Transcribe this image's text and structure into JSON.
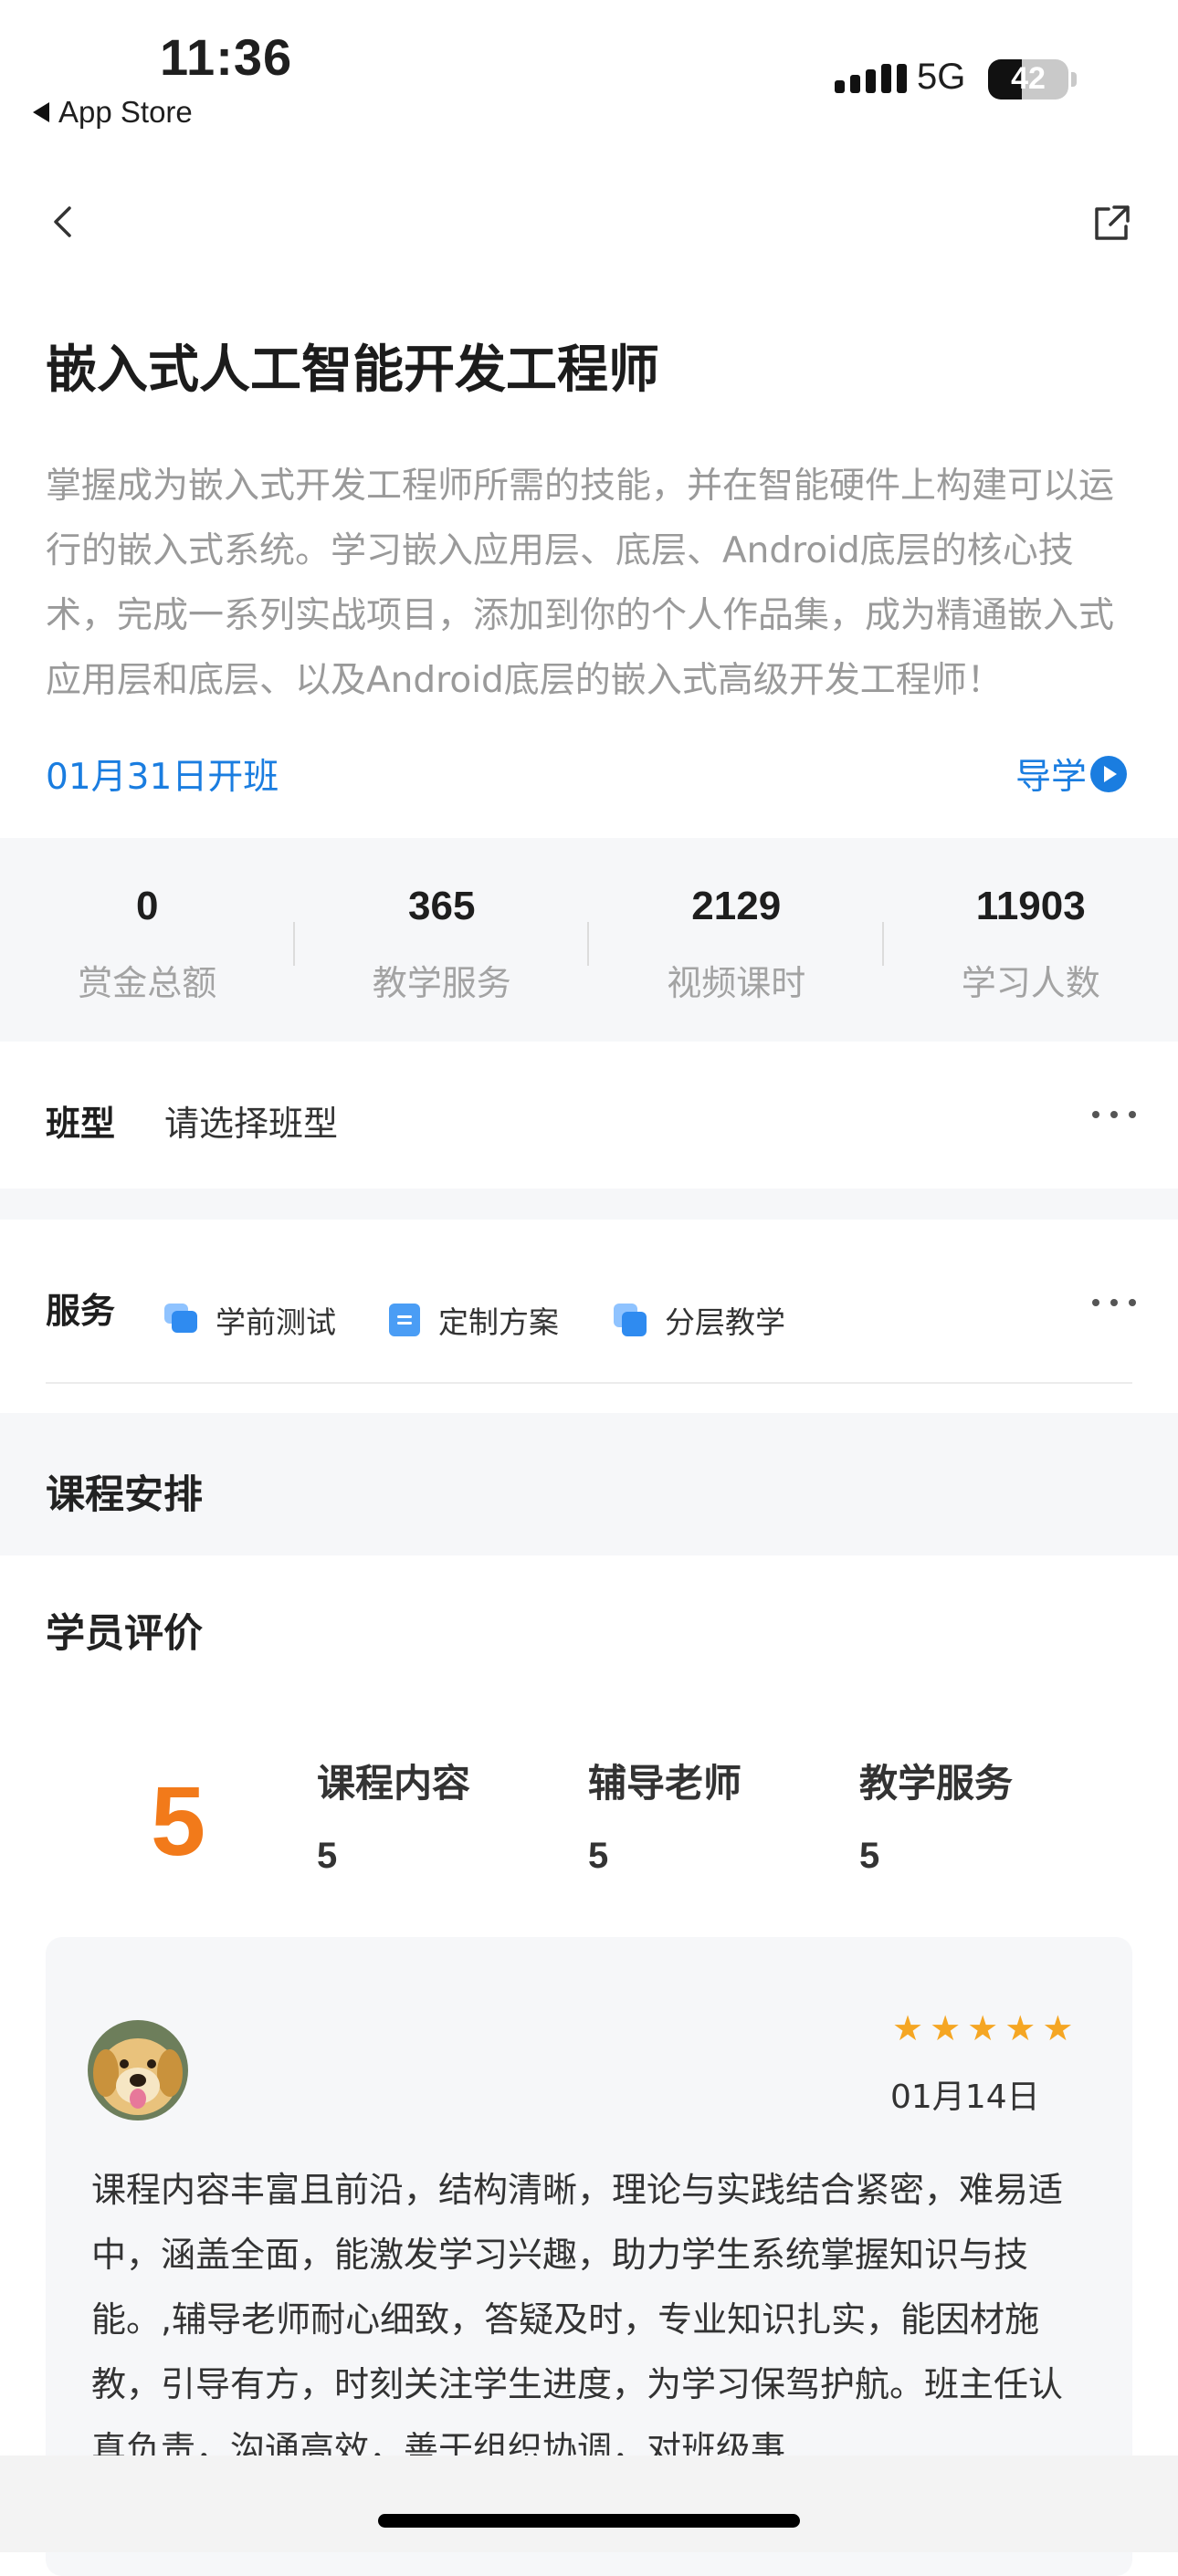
{
  "status_bar": {
    "time": "11:36",
    "back_app": "App Store",
    "network": "5G",
    "battery": "42",
    "battery_level_percent": 42
  },
  "nav": {
    "back_icon": "chevron-left-icon",
    "share_icon": "share-external-icon"
  },
  "course": {
    "title": "嵌入式人工智能开发工程师",
    "description": "掌握成为嵌入式开发工程师所需的技能，并在智能硬件上构建可以运行的嵌入式系统。学习嵌入应用层、底层、Android底层的核心技术，完成一系列实战项目，添加到你的个人作品集，成为精通嵌入式应用层和底层、以及Android底层的嵌入式高级开发工程师！",
    "start_date": "01月31日开班",
    "guide_label": "导学"
  },
  "stats": [
    {
      "value": "0",
      "label": "赏金总额"
    },
    {
      "value": "365",
      "label": "教学服务"
    },
    {
      "value": "2129",
      "label": "视频课时"
    },
    {
      "value": "11903",
      "label": "学习人数"
    }
  ],
  "class_type": {
    "label": "班型",
    "value": "请选择班型"
  },
  "services": {
    "label": "服务",
    "items": [
      {
        "label": "学前测试",
        "icon": "chat-bubbles-icon"
      },
      {
        "label": "定制方案",
        "icon": "document-icon"
      },
      {
        "label": "分层教学",
        "icon": "layers-icon"
      }
    ]
  },
  "schedule": {
    "title": "课程安排"
  },
  "reviews": {
    "title": "学员评价",
    "overall_score": "5",
    "sub_scores": [
      {
        "label": "课程内容",
        "value": "5"
      },
      {
        "label": "辅导老师",
        "value": "5"
      },
      {
        "label": "教学服务",
        "value": "5"
      }
    ],
    "first_review": {
      "stars": 5,
      "date": "01月14日",
      "text": "课程内容丰富且前沿，结构清晰，理论与实践结合紧密，难易适中，涵盖全面，能激发学习兴趣，助力学生系统掌握知识与技能。,辅导老师耐心细致，答疑及时，专业知识扎实，能因材施教，引导有方，时刻关注学生进度，为学习保驾护航。班主任认真负责，沟通高效，善于组织协调，对班级事"
    }
  },
  "colors": {
    "accent_blue": "#1a7de0",
    "score_orange": "#f27a1a",
    "star_gold": "#f5a623",
    "muted_gray": "#9a9a9a"
  }
}
